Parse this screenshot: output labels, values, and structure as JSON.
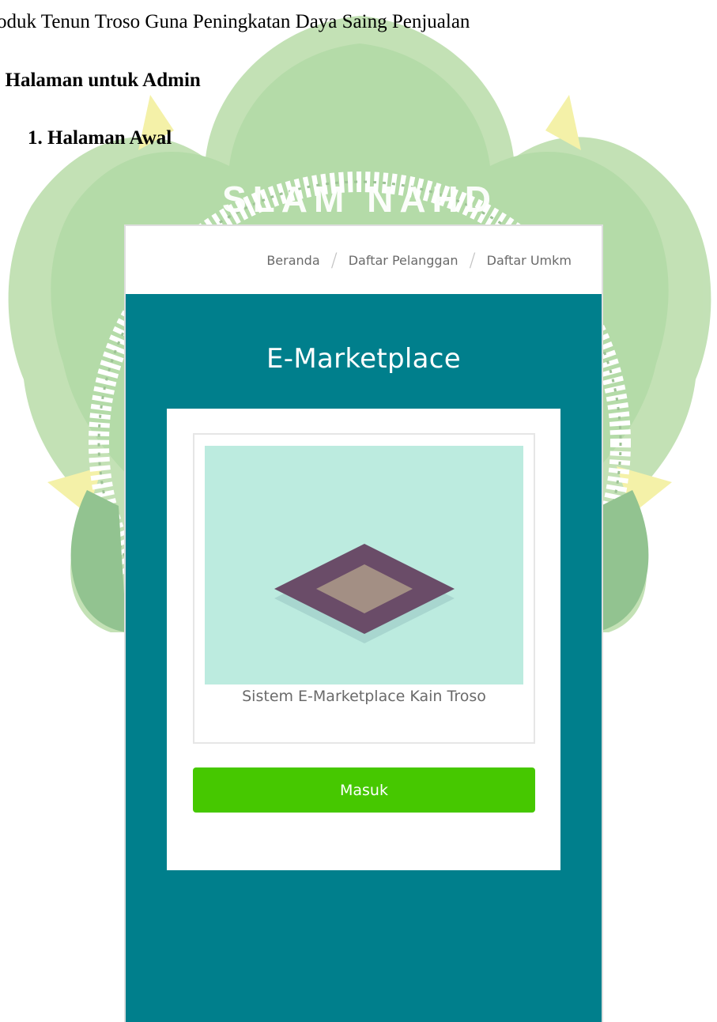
{
  "document": {
    "running_head": "oduk Tenun Troso Guna Peningkatan Daya Saing Penjualan",
    "section_heading": ". Halaman untuk Admin",
    "subsection_heading": "1.   Halaman Awal",
    "watermark_text": "SLAM NAHD"
  },
  "app": {
    "nav": {
      "items": [
        "Beranda",
        "Daftar Pelanggan",
        "Daftar Umkm"
      ],
      "separator": "/"
    },
    "hero_title": "E-Marketplace",
    "card": {
      "caption": "Sistem E-Marketplace Kain Troso",
      "image": "isometric-tile-illustration"
    },
    "login_button_label": "Masuk",
    "colors": {
      "hero_bg": "#007f8c",
      "button_bg": "#46c800",
      "card_image_bg": "#bcebdf",
      "tile_outer": "#6a4c68",
      "tile_inner": "#a38f84",
      "watermark_green": "#a8d59a",
      "watermark_yellow": "#f3ef99"
    }
  }
}
